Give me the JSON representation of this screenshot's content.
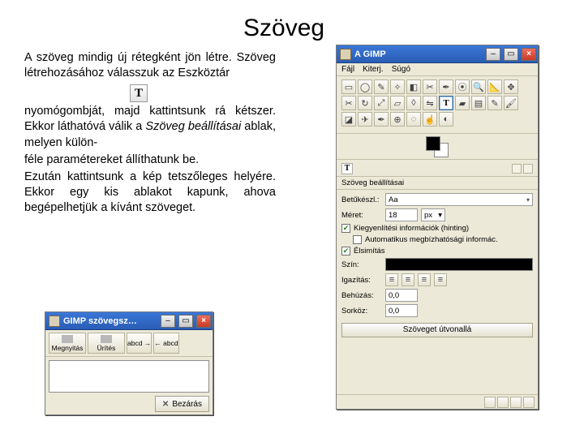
{
  "title": "Szöveg",
  "para1": "A szöveg mindig új rétegként jön létre. Szöveg létrehozásához válasszuk az Eszköztár",
  "toolGlyph": "T",
  "para2a": " nyomógombját, majd kattintsunk rá kétszer. Ekkor láthatóvá válik a ",
  "para2ital": "Szöveg beállításai",
  "para2b": " ablak, melyen külön-",
  "para3": "féle paramétereket állíthatunk be.",
  "para4": "Ezután kattintsunk a kép tetszőleges helyére. Ekkor egy kis ablakot kapunk, ahova begépelhetjük a kívánt szöveget.",
  "editor": {
    "title": "GIMP szövegsz…",
    "open": "Megnyitás",
    "clear": "Ürítés",
    "ltr": "abcd →",
    "rtl": "← abcd",
    "close": "Bezárás"
  },
  "toolbox": {
    "title": "A GIMP",
    "menu": {
      "file": "Fájl",
      "xtns": "Kiterj.",
      "help": "Súgó"
    },
    "selectedTool": "T",
    "settingsTitle": "Szöveg beállításai",
    "fontLabel": "Betűkészl.:",
    "fontValue": "Aa",
    "sizeLabel": "Méret:",
    "sizeValue": "18",
    "sizeUnit": "px",
    "hint1": "Kiegyenlítési információk (hinting)",
    "hint2": "Automatikus megbízhatósági informác.",
    "aa": "Élsimítás",
    "colorLabel": "Szín:",
    "justifyLabel": "Igazítás:",
    "indentLabel": "Behúzás:",
    "indentValue": "0,0",
    "lineLabel": "Sorköz:",
    "lineValue": "0,0",
    "pathBtn": "Szöveget útvonallá"
  }
}
